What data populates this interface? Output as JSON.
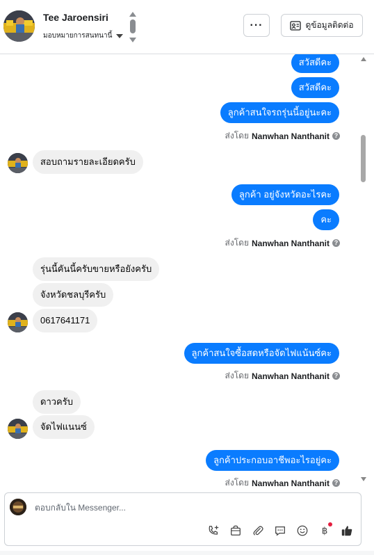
{
  "header": {
    "contact_name": "Tee Jaroensiri",
    "assign_label": "มอบหมายการสนทนานี้",
    "more_label": "···",
    "contact_info_label": "ดูข้อมูลติดต่อ"
  },
  "sent_by": {
    "prefix": "ส่งโดย",
    "agent": "Nanwhan Nanthanit"
  },
  "messages": {
    "out_1": "สวัสดีคะ",
    "out_2": "สวัสดีคะ",
    "out_3": "ลูกค้าสนใจรถรุ่นนี้อยู่นะคะ",
    "in_1": "สอบถามรายละเอียดครับ",
    "out_4": "ลูกค้า อยู่จังหวัดอะไรคะ",
    "out_5": "คะ",
    "in_2": "รุ่นนี้คันนี้ครับขายหรือยังครับ",
    "in_3": "จังหวัดชลบุรีครับ",
    "in_4": "0617641171",
    "out_6": "ลูกค้าสนใจซื้อสดหรือจัดไฟแน้นซ์คะ",
    "in_5": "ดาวครับ",
    "in_6": "จัดไฟแนนซ์",
    "out_7": "ลูกค้าประกอบอาชีพอะไรอยู่คะ"
  },
  "composer": {
    "placeholder": "ตอบกลับใน Messenger...",
    "tools": [
      "call-add-icon",
      "shop-bag-icon",
      "attachment-icon",
      "saved-reply-icon",
      "emoji-icon",
      "baht-payment-icon",
      "thumbs-up-icon"
    ]
  },
  "colors": {
    "outgoing_bubble": "#0a7cff",
    "incoming_bubble": "#f0f0f0",
    "notification_dot": "#e41e3f"
  }
}
